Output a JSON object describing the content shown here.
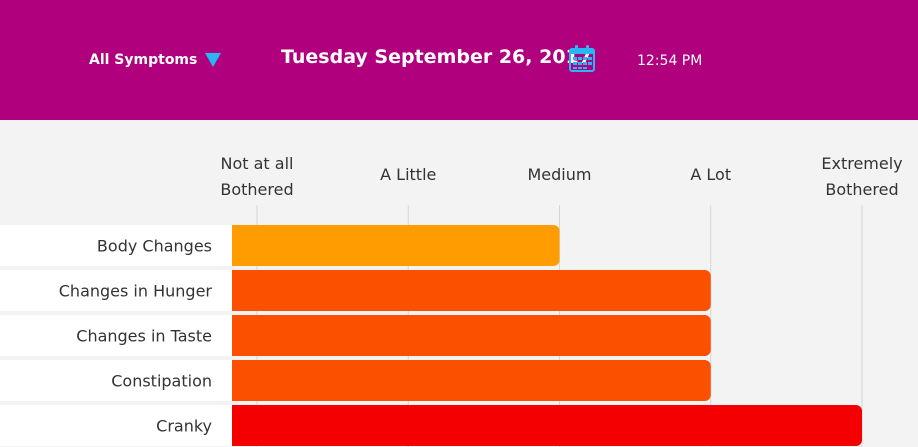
{
  "header": {
    "filter_label": "All Symptoms",
    "date": "Tuesday September 26, 2017",
    "time": "12:54 PM",
    "background": "#b0007e",
    "accent": "#29b6f6"
  },
  "chart_data": {
    "type": "bar",
    "orientation": "horizontal",
    "ticks": [
      {
        "value": 0,
        "lines": [
          "Not at all",
          "Bothered"
        ]
      },
      {
        "value": 1,
        "lines": [
          "A Little"
        ]
      },
      {
        "value": 2,
        "lines": [
          "Medium"
        ]
      },
      {
        "value": 3,
        "lines": [
          "A Lot"
        ]
      },
      {
        "value": 4,
        "lines": [
          "Extremely",
          "Bothered"
        ]
      }
    ],
    "xlim": [
      0,
      4
    ],
    "categories": [
      "Body Changes",
      "Changes in Hunger",
      "Changes in Taste",
      "Constipation",
      "Cranky"
    ],
    "values": [
      2,
      3,
      3,
      3,
      4
    ],
    "colors": [
      "#ff9c00",
      "#fb5000",
      "#fb5000",
      "#fb5000",
      "#f40000"
    ],
    "grid": true
  }
}
